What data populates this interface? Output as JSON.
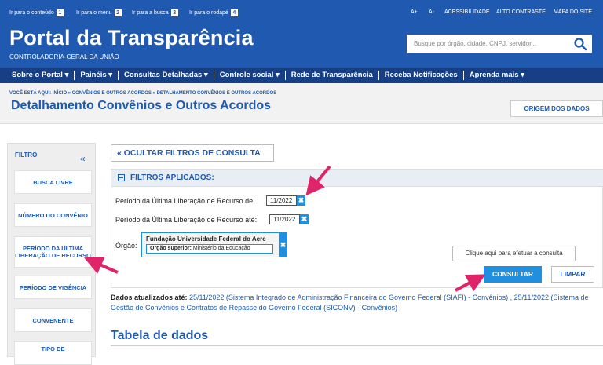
{
  "skip_links": [
    {
      "label": "Ir para o conteúdo",
      "key": "1"
    },
    {
      "label": "Ir para o menu",
      "key": "2"
    },
    {
      "label": "Ir para a busca",
      "key": "3"
    },
    {
      "label": "Ir para o rodapé",
      "key": "4"
    }
  ],
  "utility_links": [
    "A+",
    "A-",
    "ACESSIBILIDADE",
    "ALTO CONTRASTE",
    "MAPA DO SITE"
  ],
  "header": {
    "title": "Portal da Transparência",
    "subtitle": "CONTROLADORIA-GERAL DA UNIÃO",
    "search_placeholder": "Busque por órgão, cidade, CNPJ, servidor..."
  },
  "nav": [
    "Sobre o Portal ▾",
    "Painéis ▾",
    "Consultas Detalhadas ▾",
    "Controle social ▾",
    "Rede de Transparência",
    "Receba Notificações",
    "Aprenda mais ▾"
  ],
  "breadcrumb": "VOCÊ ESTÁ AQUI: INÍCIO » CONVÊNIOS E OUTROS ACORDOS » DETALHAMENTO CONVÊNIOS E OUTROS ACORDOS",
  "page_title": "Detalhamento Convênios e Outros Acordos",
  "origem_label": "ORIGEM DOS DADOS",
  "sidebar": {
    "title": "FILTRO",
    "collapse": "«",
    "items": [
      "BUSCA LIVRE",
      "NÚMERO DO CONVÊNIO",
      "PERÍODO DA ÚLTIMA LIBERAÇÃO DE RECURSO",
      "PERÍODO DE VIGÊNCIA",
      "CONVENENTE",
      "TIPO DE"
    ]
  },
  "ocultar_label": "« OCULTAR FILTROS DE CONSULTA",
  "filters": {
    "title": "FILTROS APLICADOS:",
    "rows": [
      {
        "label": "Período da Última Liberação de Recurso de:",
        "value": "11/2022"
      },
      {
        "label": "Período da Última Liberação de Recurso até:",
        "value": "11/2022"
      }
    ],
    "orgao_label": "Órgão:",
    "orgao_name": "Fundação Universidade Federal do Acre",
    "orgao_superior_label": "Órgão superior:",
    "orgao_superior_value": "Ministério da Educação",
    "remove_glyph": "✖"
  },
  "clique_label": "Clique aqui para efetuar a consulta",
  "consultar_label": "CONSULTAR",
  "limpar_label": "LIMPAR",
  "dados": {
    "label": "Dados atualizados até:",
    "text": "25/11/2022 (Sistema Integrado de Administração Financeira do Governo Federal (SIAFI) - Convênios) , 25/11/2022 (Sistema de Gestão de Convênios e Contratos de Repasse do Governo Federal (SICONV) - Convênios)"
  },
  "table_title": "Tabela de dados",
  "colors": {
    "primary": "#1f5ab0",
    "nav": "#163f86",
    "accent": "#1f90e0",
    "arrow": "#e0246a"
  }
}
